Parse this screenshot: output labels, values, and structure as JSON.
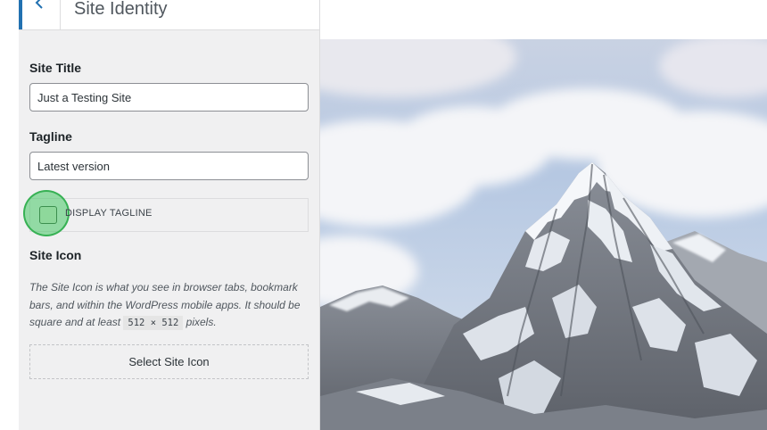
{
  "panel": {
    "back_icon": "chevron-left-icon",
    "title": "Site Identity",
    "accent_color": "#2271b1"
  },
  "fields": {
    "site_title_label": "Site Title",
    "site_title_value": "Just a Testing Site",
    "tagline_label": "Tagline",
    "tagline_value": "Latest version",
    "display_tagline_label": "DISPLAY TAGLINE",
    "display_tagline_checked": false
  },
  "site_icon": {
    "label": "Site Icon",
    "desc_part1": "The Site Icon is what you see in browser tabs, bookmark bars, and within the WordPress mobile apps. It should be square and at least ",
    "size_code": "512 × 512",
    "desc_part2": " pixels.",
    "button_label": "Select Site Icon"
  },
  "preview": {
    "image": "mountain-peak-with-snow-and-clouds"
  }
}
